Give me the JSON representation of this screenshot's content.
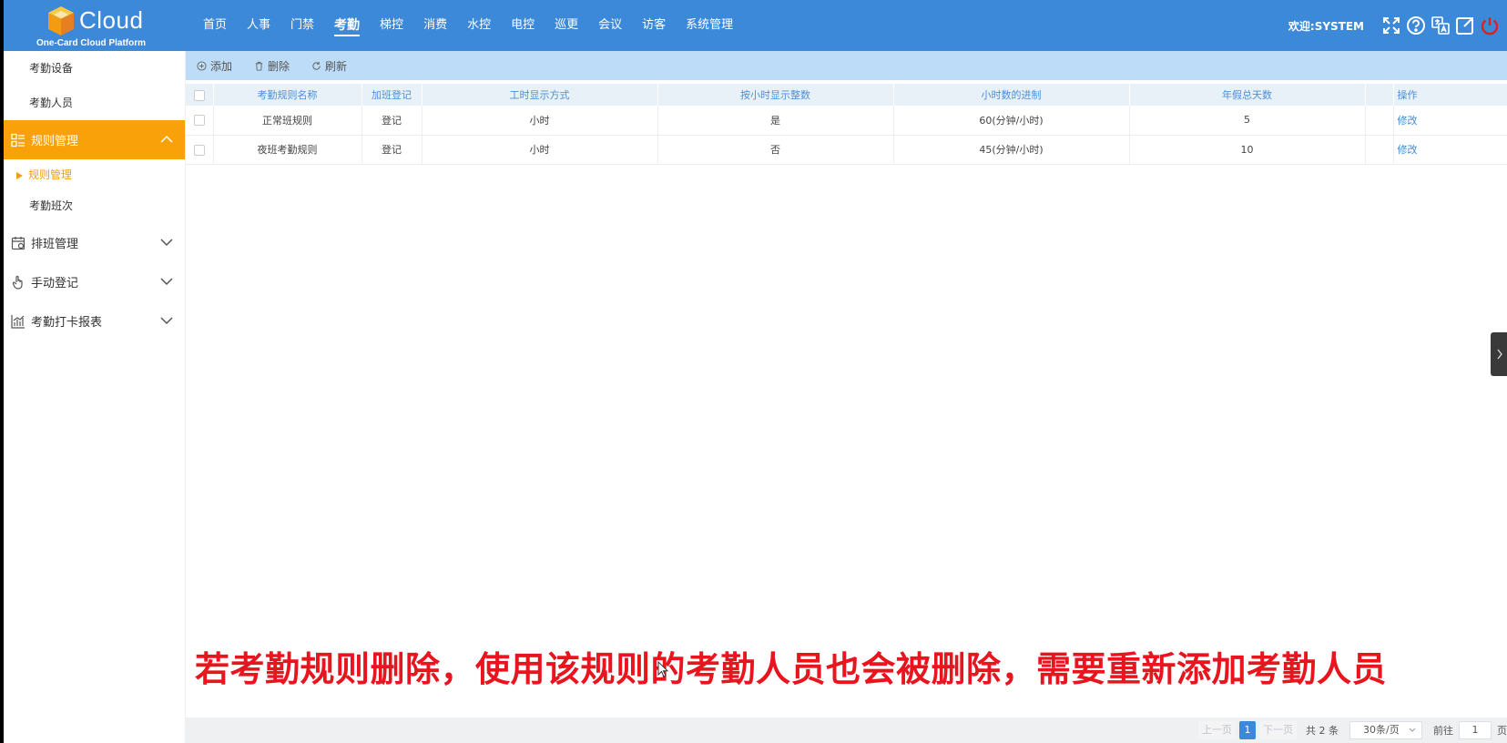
{
  "header": {
    "brand": "Cloud",
    "subtitle": "One-Card Cloud Platform",
    "nav": [
      "首页",
      "人事",
      "门禁",
      "考勤",
      "梯控",
      "消费",
      "水控",
      "电控",
      "巡更",
      "会议",
      "访客",
      "系统管理"
    ],
    "active_nav": "考勤",
    "welcome": "欢迎:SYSTEM",
    "icons": [
      "fullscreen-icon",
      "help-icon",
      "translate-icon",
      "external-link-icon",
      "power-icon"
    ]
  },
  "sidebar": {
    "top_links": [
      "考勤设备",
      "考勤人员"
    ],
    "open_group": {
      "label": "规则管理",
      "icon": "rules-icon"
    },
    "sub_items": [
      {
        "label": "规则管理",
        "active": true
      },
      {
        "label": "考勤班次",
        "active": false
      }
    ],
    "groups": [
      {
        "label": "排班管理",
        "icon": "calendar-icon"
      },
      {
        "label": "手动登记",
        "icon": "hand-icon"
      },
      {
        "label": "考勤打卡报表",
        "icon": "chart-icon"
      }
    ]
  },
  "toolbar": {
    "add": "添加",
    "delete": "删除",
    "refresh": "刷新"
  },
  "table": {
    "columns": [
      "考勤规则名称",
      "加班登记",
      "工时显示方式",
      "按小时显示整数",
      "小时数的进制",
      "年假总天数",
      "操作"
    ],
    "rows": [
      {
        "name": "正常班规则",
        "overtime": "登记",
        "display": "小时",
        "integer": "是",
        "base": "60(分钟/小时)",
        "annual": "5",
        "action": "修改"
      },
      {
        "name": "夜班考勤规则",
        "overtime": "登记",
        "display": "小时",
        "integer": "否",
        "base": "45(分钟/小时)",
        "annual": "10",
        "action": "修改"
      }
    ]
  },
  "caption": "若考勤规则删除，使用该规则的考勤人员也会被删除，需要重新添加考勤人员",
  "pagination": {
    "prev": "上一页",
    "current": "1",
    "next": "下一页",
    "total": "共 2 条",
    "page_size": "30条/页",
    "goto": "前往",
    "goto_value": "1",
    "unit": "页"
  },
  "colors": {
    "header_bg": "#3d89d9",
    "active_group": "#f9a109",
    "toolbar_bg": "#bcdcf7",
    "caption": "#e8141e"
  }
}
